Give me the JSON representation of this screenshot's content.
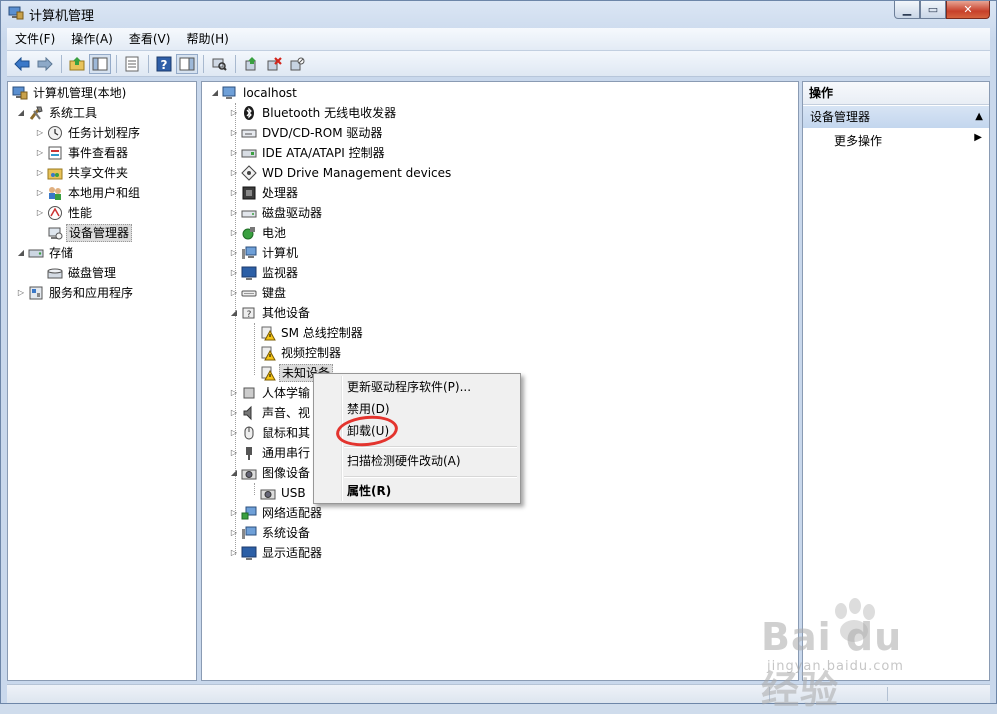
{
  "window": {
    "title": "计算机管理"
  },
  "menu": [
    "文件(F)",
    "操作(A)",
    "查看(V)",
    "帮助(H)"
  ],
  "left_tree": {
    "root": "计算机管理(本地)",
    "items": [
      {
        "label": "系统工具",
        "icon": "tools-icon"
      },
      {
        "label": "任务计划程序",
        "icon": "clock-icon"
      },
      {
        "label": "事件查看器",
        "icon": "event-viewer-icon"
      },
      {
        "label": "共享文件夹",
        "icon": "shared-folder-icon"
      },
      {
        "label": "本地用户和组",
        "icon": "users-icon"
      },
      {
        "label": "性能",
        "icon": "performance-icon"
      },
      {
        "label": "设备管理器",
        "icon": "device-manager-icon"
      },
      {
        "label": "存储",
        "icon": "storage-icon"
      },
      {
        "label": "磁盘管理",
        "icon": "disk-icon"
      },
      {
        "label": "服务和应用程序",
        "icon": "services-icon"
      }
    ]
  },
  "device_tree": {
    "root": "localhost",
    "items": [
      "Bluetooth 无线电收发器",
      "DVD/CD-ROM 驱动器",
      "IDE ATA/ATAPI 控制器",
      "WD Drive Management devices",
      "处理器",
      "磁盘驱动器",
      "电池",
      "计算机",
      "监视器",
      "键盘",
      "其他设备",
      "SM 总线控制器",
      "视频控制器",
      "未知设备",
      "人体学输",
      "声音、视",
      "鼠标和其",
      "通用串行",
      "图像设备",
      "USB",
      "网络适配器",
      "系统设备",
      "显示适配器"
    ]
  },
  "context_menu": {
    "update_driver": "更新驱动程序软件(P)...",
    "disable": "禁用(D)",
    "uninstall": "卸载(U)",
    "scan": "扫描检测硬件改动(A)",
    "properties": "属性(R)"
  },
  "actions": {
    "header": "操作",
    "section": "设备管理器",
    "more": "更多操作"
  },
  "watermark": {
    "brand": "Bai du 经验",
    "site": "jingyan.baidu.com"
  },
  "colors": {
    "highlight_circle": "#e3342e",
    "selection": "#dcdcdc"
  }
}
